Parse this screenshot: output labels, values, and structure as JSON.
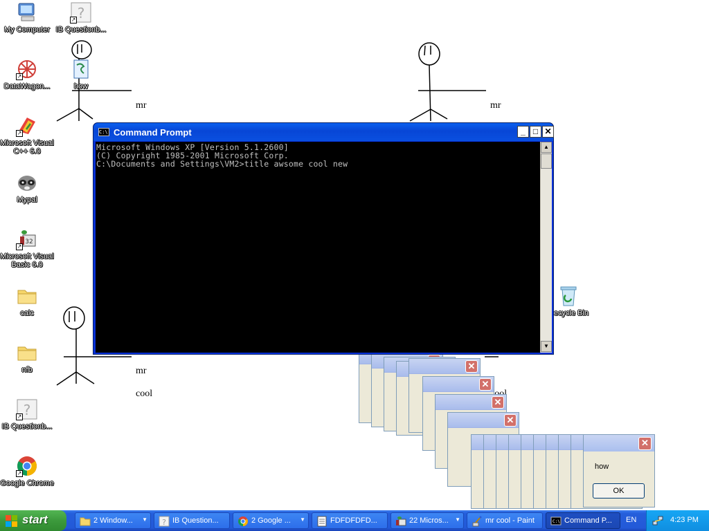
{
  "desktop_icons": [
    {
      "label": "My Computer",
      "icon": "my-computer-icon"
    },
    {
      "label": "IB Questionb...",
      "icon": "unknown-shortcut-icon"
    },
    {
      "label": "DataWagon...",
      "icon": "datawagon-icon"
    },
    {
      "label": "how",
      "icon": "script-file-icon"
    },
    {
      "label": "Microsoft Visual C++ 6.0",
      "icon": "visual-cpp-icon"
    },
    {
      "label": "Mypal",
      "icon": "mypal-raccoon-icon"
    },
    {
      "label": "Microsoft Visual Basic 6.0",
      "icon": "visual-basic-icon"
    },
    {
      "label": "calc",
      "icon": "folder-icon"
    },
    {
      "label": "nfb",
      "icon": "folder-icon"
    },
    {
      "label": "IB Questionb...",
      "icon": "unknown-shortcut-icon"
    },
    {
      "label": "Google Chrome",
      "icon": "chrome-icon"
    },
    {
      "label": "Recycle Bin",
      "icon": "recycle-bin-icon"
    }
  ],
  "paint_labels": {
    "mr_1": "mr",
    "mr_2": "mr",
    "mr_3": "mr",
    "cool_1": "cool",
    "cool_2": "cool"
  },
  "cmd": {
    "title": "Command Prompt",
    "lines": [
      "Microsoft Windows XP [Version 5.1.2600]",
      "(C) Copyright 1985-2001 Microsoft Corp.",
      "",
      "C:\\Documents and Settings\\VM2>title awsome cool new"
    ],
    "minimize": "_",
    "maximize": "□",
    "close": "✕"
  },
  "msgbox": {
    "message": "how",
    "ok_label": "OK",
    "close": "✕",
    "stack_count": 14
  },
  "taskbar": {
    "start_label": "start",
    "tasks": [
      {
        "label": "2 Window...",
        "icon": "folder-icon",
        "group": true
      },
      {
        "label": "IB Question...",
        "icon": "unknown-shortcut-icon",
        "group": false
      },
      {
        "label": "2 Google ...",
        "icon": "chrome-icon",
        "group": true
      },
      {
        "label": "FDFDFDFD...",
        "icon": "document-icon",
        "group": false
      },
      {
        "label": "22 Micros...",
        "icon": "visual-basic-icon",
        "group": true
      },
      {
        "label": "mr cool - Paint",
        "icon": "paint-icon",
        "group": false
      },
      {
        "label": "Command P...",
        "icon": "cmd-icon",
        "group": false,
        "active": true
      }
    ],
    "language": "EN",
    "clock": "4:23 PM"
  },
  "colors": {
    "xp_blue": "#0a5fee",
    "start_green": "#3c9a3c",
    "close_red": "#d2706a",
    "console_text": "#c0c0c0"
  }
}
